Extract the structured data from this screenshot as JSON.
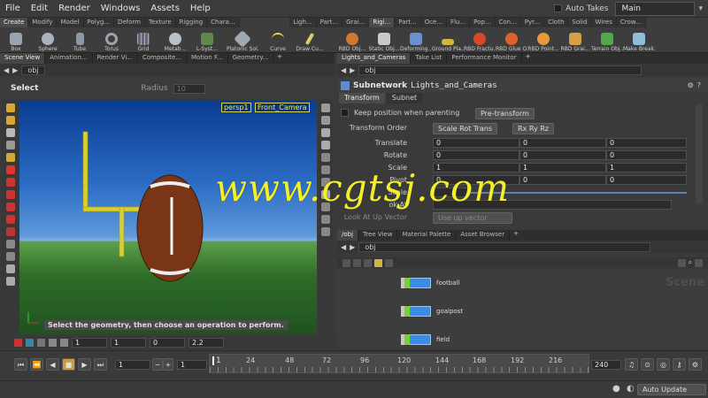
{
  "menu": [
    "File",
    "Edit",
    "Render",
    "Windows",
    "Assets",
    "Help"
  ],
  "auto_takes": "Auto Takes",
  "desktop": "Main",
  "shelf_tabs_left": [
    "Create",
    "Modify",
    "Model",
    "Polyg...",
    "Deform",
    "Texture",
    "Rigging",
    "Chara..."
  ],
  "shelf_tabs_right": [
    "Ligh...",
    "Part...",
    "Grai...",
    "Rigi...",
    "Part...",
    "Oce...",
    "Flu...",
    "Pop...",
    "Con...",
    "Pyr...",
    "Cloth",
    "Solid",
    "Wires",
    "Crow..."
  ],
  "shelf_tools_left": [
    "Box",
    "Sphere",
    "Tube",
    "Torus",
    "Grid",
    "Metab...",
    "L-Syst...",
    "Platonic Sol...",
    "Curve",
    "Draw Cu..."
  ],
  "shelf_tools_right": [
    "RBD Obj...",
    "Static Obj...",
    "Deforming...",
    "Ground Pla...",
    "RBD Fractu...",
    "RBD Glue O...",
    "RBD Point...",
    "RBD Grai...",
    "Terrain Obj...",
    "Make Break..."
  ],
  "left_tabs": [
    "Scene View",
    "Animation...",
    "Render Vi...",
    "Composite...",
    "Motion F...",
    "Geometry..."
  ],
  "right_top_tabs": [
    "Lights_and_Cameras",
    "Take List",
    "Performance Monitor"
  ],
  "path_obj": "obj",
  "select_label": "Select",
  "radius_label": "Radius",
  "radius_value": "10",
  "persp": "persp1",
  "camera": "Front_Camera",
  "viewport_hint": "Select the geometry, then choose an operation to perform.",
  "vp_bottom": {
    "v1": "1",
    "v2": "1",
    "v3": "0",
    "v4": "2.2"
  },
  "subnetwork_label": "Subnetwork",
  "subnetwork_name": "Lights_and_Cameras",
  "param_tabs": [
    "Transform",
    "Subnet"
  ],
  "keep_position": "Keep position when parenting",
  "pre_transform": "Pre-transform",
  "transform_order_label": "Transform Order",
  "transform_order": "Scale Rot Trans",
  "rot_order": "Rx Ry Rz",
  "params": [
    {
      "label": "Translate",
      "values": [
        "0",
        "0",
        "0"
      ]
    },
    {
      "label": "Rotate",
      "values": [
        "0",
        "0",
        "0"
      ]
    },
    {
      "label": "Scale",
      "values": [
        "1",
        "1",
        "1"
      ]
    },
    {
      "label": "Pivot",
      "values": [
        "0",
        "0",
        "0"
      ]
    }
  ],
  "uniform_scale": "Scale",
  "lookat_label": "Look At Up Vector",
  "lookat_value": "Use up vector",
  "lookat_partial": "ok At",
  "net_tabs": [
    "/obj",
    "Tree View",
    "Material Palette",
    "Asset Browser"
  ],
  "scene_label": "Scene",
  "nodes": [
    {
      "name": "football"
    },
    {
      "name": "goalpost"
    },
    {
      "name": "field"
    }
  ],
  "frame_current": "1",
  "frame_step": "1",
  "frame_start": "1",
  "frame_end": "240",
  "ruler_ticks": [
    "1",
    "24",
    "48",
    "72",
    "96",
    "120",
    "144",
    "168",
    "192",
    "216"
  ],
  "auto_update": "Auto Update",
  "watermark": "www.cgtsj.com"
}
